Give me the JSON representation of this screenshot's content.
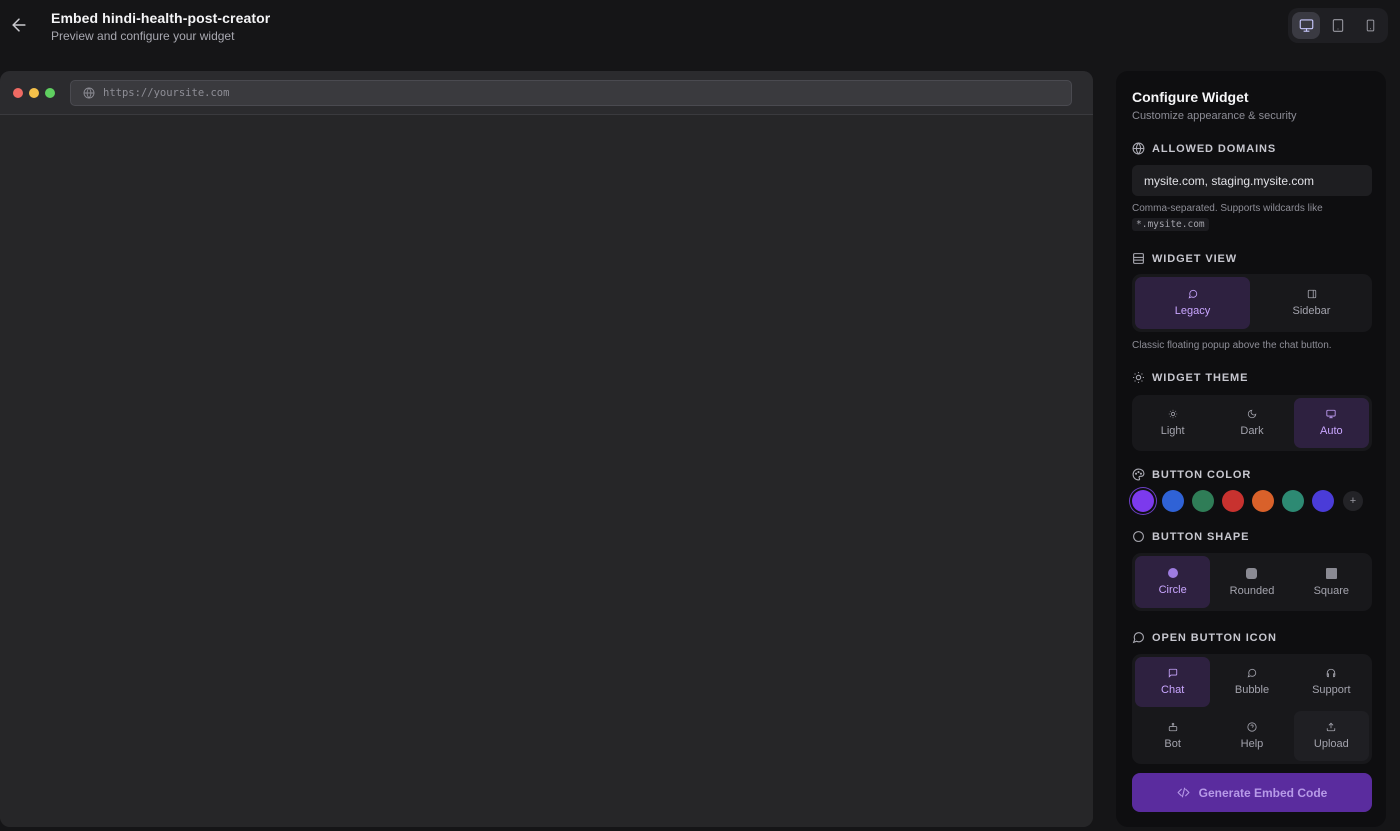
{
  "header": {
    "title": "Embed hindi-health-post-creator",
    "subtitle": "Preview and configure your widget",
    "back_icon": "arrow-left-icon",
    "devices": [
      {
        "id": "desktop",
        "icon": "monitor-icon",
        "active": true
      },
      {
        "id": "tablet",
        "icon": "tablet-icon",
        "active": false
      },
      {
        "id": "mobile",
        "icon": "smartphone-icon",
        "active": false
      }
    ]
  },
  "preview": {
    "url": "https://yoursite.com",
    "traffic_lights": [
      "#ef6a63",
      "#f4c04a",
      "#5fcf60"
    ]
  },
  "panel": {
    "title": "Configure Widget",
    "subtitle": "Customize appearance & security",
    "allowed_domains": {
      "label": "ALLOWED DOMAINS",
      "value": "mysite.com, staging.mysite.com",
      "hint": "Comma-separated. Supports wildcards like",
      "hint_code": "*.mysite.com"
    },
    "widget_view": {
      "label": "WIDGET VIEW",
      "options": [
        {
          "label": "Legacy",
          "icon": "message-circle-icon",
          "active": true
        },
        {
          "label": "Sidebar",
          "icon": "sidebar-panel-icon",
          "active": false
        }
      ],
      "hint": "Classic floating popup above the chat button."
    },
    "widget_theme": {
      "label": "WIDGET THEME",
      "options": [
        {
          "label": "Light",
          "icon": "sun-icon",
          "active": false
        },
        {
          "label": "Dark",
          "icon": "moon-icon",
          "active": false
        },
        {
          "label": "Auto",
          "icon": "monitor-icon",
          "active": true
        }
      ]
    },
    "button_color": {
      "label": "BUTTON COLOR",
      "swatches": [
        "#7c3aed",
        "#2f62d6",
        "#2f7d57",
        "#c8322f",
        "#d9612a",
        "#2d8a73",
        "#4a3cd8"
      ],
      "selected": "#7c3aed",
      "add_label": "+"
    },
    "button_shape": {
      "label": "BUTTON SHAPE",
      "options": [
        {
          "label": "Circle",
          "active": true
        },
        {
          "label": "Rounded",
          "active": false
        },
        {
          "label": "Square",
          "active": false
        }
      ]
    },
    "open_button_icon": {
      "label": "OPEN BUTTON ICON",
      "options": [
        {
          "label": "Chat",
          "icon": "message-square-icon",
          "active": true
        },
        {
          "label": "Bubble",
          "icon": "message-circle-icon",
          "active": false
        },
        {
          "label": "Support",
          "icon": "headphones-icon",
          "active": false
        },
        {
          "label": "Bot",
          "icon": "bot-icon",
          "active": false
        },
        {
          "label": "Help",
          "icon": "help-circle-icon",
          "active": false
        },
        {
          "label": "Upload",
          "icon": "upload-icon",
          "active": false
        }
      ]
    },
    "generate_button": {
      "label": "Generate Embed Code",
      "icon": "code-icon"
    },
    "accent_color": "#7c3aed"
  }
}
